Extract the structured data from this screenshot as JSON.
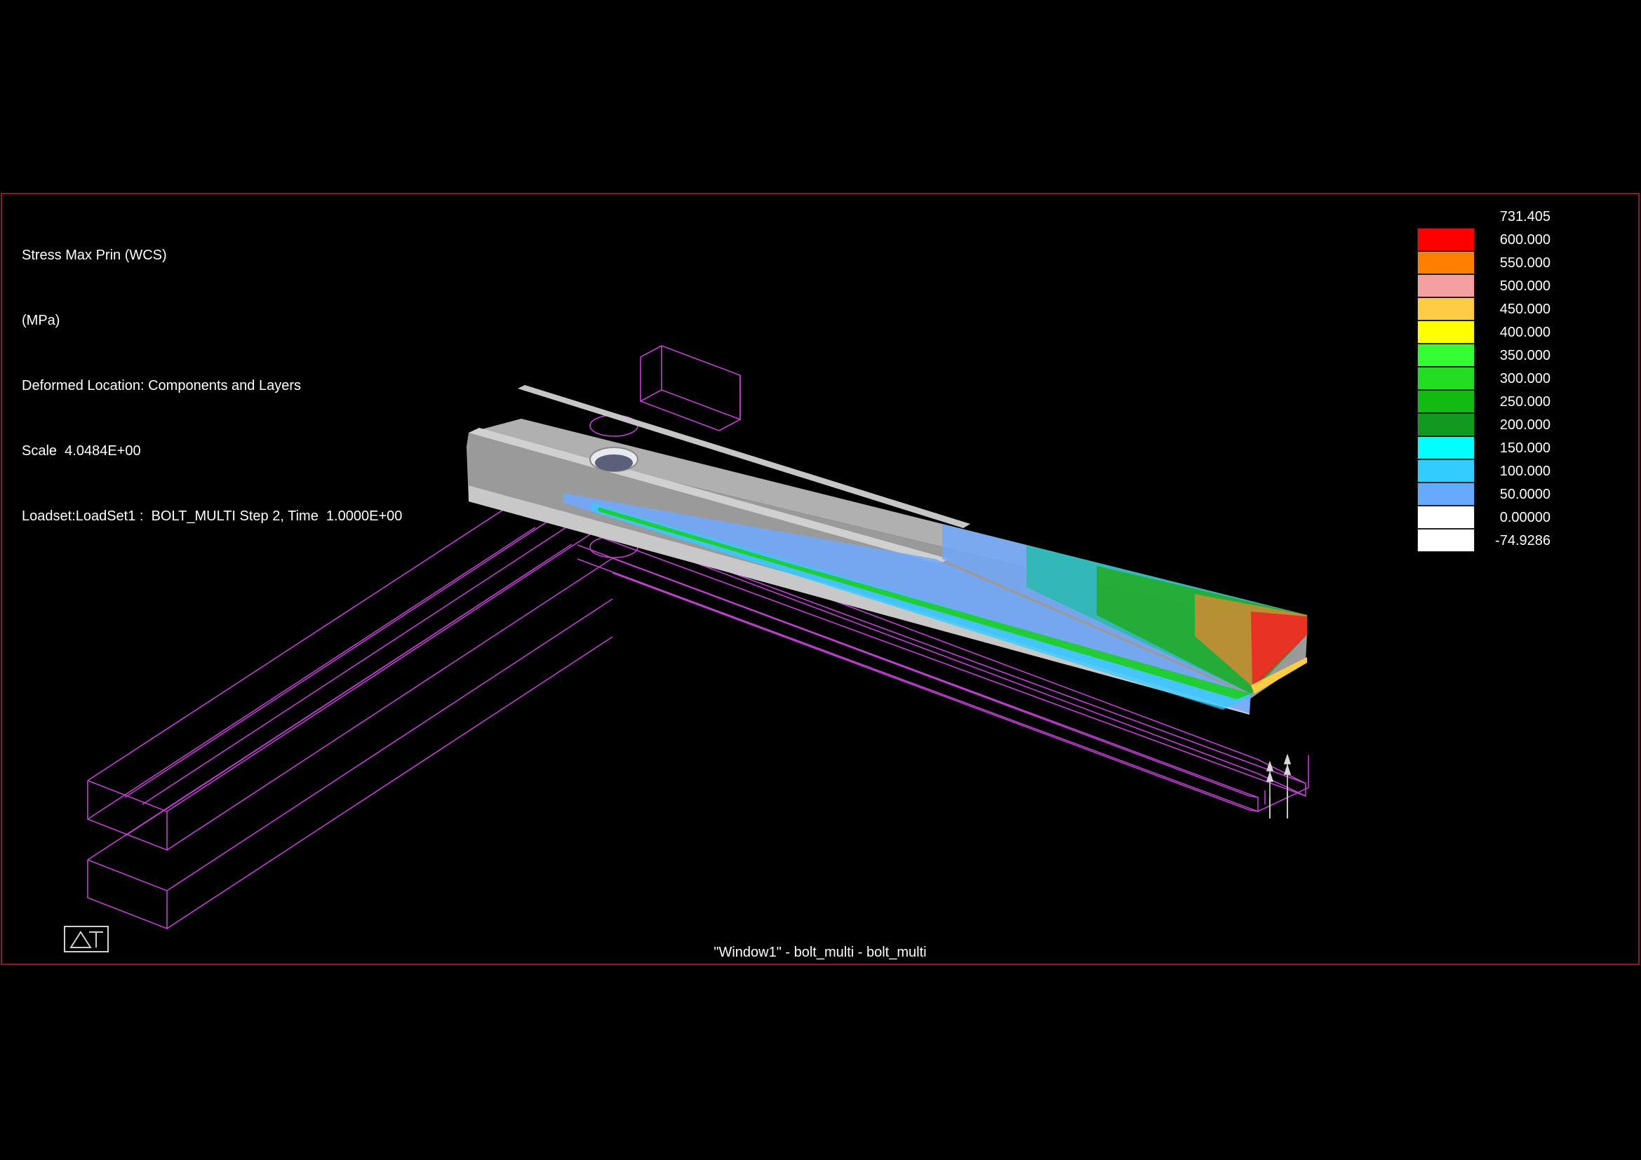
{
  "info": {
    "result_title": "Stress Max Prin (WCS)",
    "units": "(MPa)",
    "deformed_location": "Deformed Location: Components and Layers",
    "scale": "Scale  4.0484E+00",
    "loadset": "Loadset:LoadSet1 :  BOLT_MULTI Step 2, Time  1.0000E+00"
  },
  "legend": {
    "labels": [
      "731.405",
      "600.000",
      "550.000",
      "500.000",
      "450.000",
      "400.000",
      "350.000",
      "300.000",
      "250.000",
      "200.000",
      "150.000",
      "100.000",
      "50.0000",
      "0.00000",
      "-74.9286"
    ],
    "colors": [
      "#ff0000",
      "#ff7f00",
      "#f4a0a0",
      "#ffcc44",
      "#ffff00",
      "#33ff33",
      "#22dd22",
      "#11bb11",
      "#119922",
      "#00ffff",
      "#33ccff",
      "#66aaff",
      "#ffffff",
      "#ffffff"
    ]
  },
  "window_caption": "\"Window1\" - bolt_multi - bolt_multi",
  "logo": {
    "icon": "at-logo-icon"
  },
  "colors": {
    "frame_border": "#8b1a2e",
    "wireframe": "#c040d0",
    "model_gray": "#b8b8b8"
  }
}
